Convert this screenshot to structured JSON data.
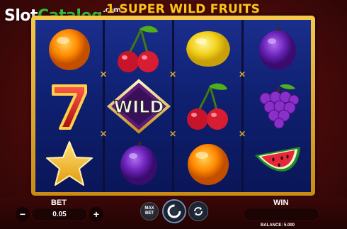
{
  "watermark": {
    "part1": "Slot",
    "part2": "Catalog",
    "suffix": ".com"
  },
  "title": "SUPER WILD FRUITS",
  "title_prefix": "1",
  "reels": [
    [
      "orange",
      "seven",
      "star"
    ],
    [
      "cherries",
      "wild",
      "plum"
    ],
    [
      "lemon",
      "cherries",
      "orange"
    ],
    [
      "plum",
      "grapes",
      "watermelon"
    ]
  ],
  "wild_label": "WILD",
  "controls": {
    "bet_label": "BET",
    "bet_value": "0.05",
    "minus": "−",
    "plus": "+",
    "maxbet_line1": "MAX",
    "maxbet_line2": "BET",
    "win_label": "WIN",
    "win_value": "",
    "balance": "BALANCE: 5.000"
  },
  "colors": {
    "frame_gold": "#f5c94a",
    "reel_blue": "#1a2e8c",
    "background_red": "#7a1414",
    "title_gold": "#ffc21a",
    "watermark_green": "#3bbf3b"
  },
  "icons": {
    "spin": "spin-icon",
    "autoplay": "autoplay-icon",
    "separator": "x-separator-icon"
  }
}
